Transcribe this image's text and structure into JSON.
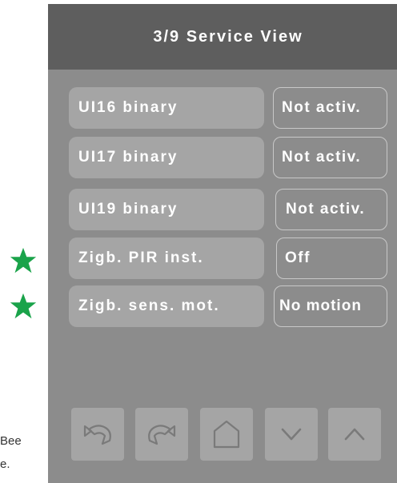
{
  "side_note": {
    "line1": "Bee",
    "line2": "e."
  },
  "colors": {
    "star": "#1aa34a",
    "header_bg": "#5e5e5e",
    "panel_bg": "#8c8c8c",
    "label_bg": "#a5a5a5"
  },
  "header": {
    "title": "3/9 Service View"
  },
  "rows": [
    {
      "label": "UI16 binary",
      "value": "Not activ.",
      "starred": false
    },
    {
      "label": "UI17 binary",
      "value": "Not activ.",
      "starred": false
    },
    {
      "label": "UI19 binary",
      "value": "Not activ.",
      "starred": false
    },
    {
      "label": "Zigb. PIR inst.",
      "value": "Off",
      "starred": true
    },
    {
      "label": "Zigb. sens. mot.",
      "value": "No motion",
      "starred": true
    }
  ],
  "nav": {
    "buttons": [
      {
        "icon": "undo-icon"
      },
      {
        "icon": "redo-icon"
      },
      {
        "icon": "home-icon"
      },
      {
        "icon": "chevron-down-icon"
      },
      {
        "icon": "chevron-up-icon"
      }
    ]
  }
}
